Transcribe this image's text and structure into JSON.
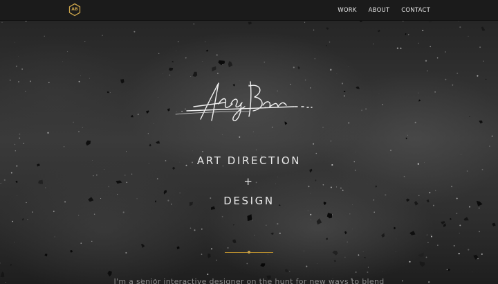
{
  "logo": {
    "text": "AB",
    "color": "#c9a24a"
  },
  "nav": {
    "items": [
      "WORK",
      "ABOUT",
      "CONTACT"
    ]
  },
  "hero": {
    "line1": "ART DIRECTION",
    "line2": "+",
    "line3": "DESIGN",
    "intro": "I'm a senior interactive designer on the hunt for new ways to blend"
  },
  "colors": {
    "accent": "#c9a24a",
    "navbar": "#1b1b1b",
    "text": "#e8e8e8"
  },
  "icons": {
    "logo": "hexagon-logo-icon",
    "signature": "signature-graphic"
  }
}
